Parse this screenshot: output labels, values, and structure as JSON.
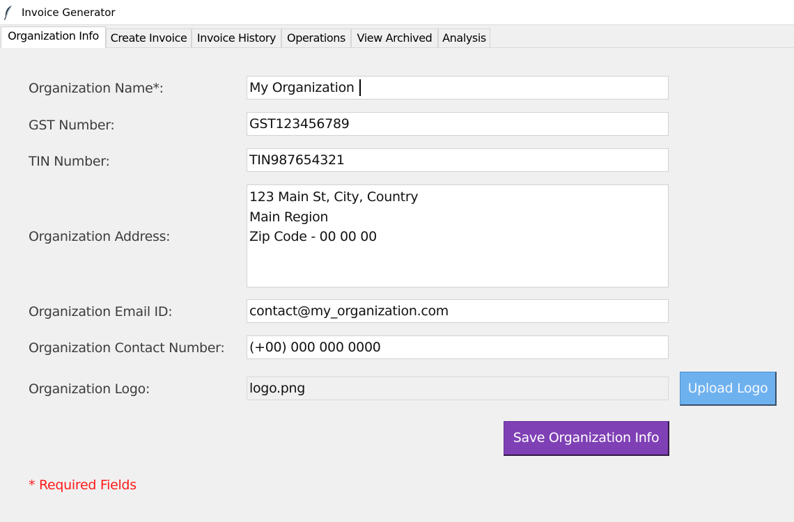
{
  "window": {
    "title": "Invoice Generator",
    "icon": "feather-icon"
  },
  "tabs": [
    {
      "label": "Organization Info",
      "active": true
    },
    {
      "label": "Create Invoice",
      "active": false
    },
    {
      "label": "Invoice History",
      "active": false
    },
    {
      "label": "Operations",
      "active": false
    },
    {
      "label": "View Archived",
      "active": false
    },
    {
      "label": "Analysis",
      "active": false
    }
  ],
  "form": {
    "org_name": {
      "label": "Organization Name*:",
      "value": "My Organization"
    },
    "gst": {
      "label": "GST Number:",
      "value": "GST123456789"
    },
    "tin": {
      "label": "TIN Number:",
      "value": "TIN987654321"
    },
    "address": {
      "label": "Organization Address:",
      "value": "123 Main St, City, Country\nMain Region\nZip Code - 00 00 00"
    },
    "email": {
      "label": "Organization Email ID:",
      "value": "contact@my_organization.com"
    },
    "contact": {
      "label": "Organization Contact Number:",
      "value": "(+00) 000 000 0000"
    },
    "logo": {
      "label": "Organization Logo:",
      "value": "logo.png"
    }
  },
  "buttons": {
    "upload_logo": "Upload Logo",
    "save_org_info": "Save Organization Info"
  },
  "required_note": "* Required Fields",
  "colors": {
    "upload_button": "#6eb1ef",
    "save_button": "#7f40b5",
    "required_text": "#ff1a1a",
    "window_bg": "#f0f0f0"
  }
}
